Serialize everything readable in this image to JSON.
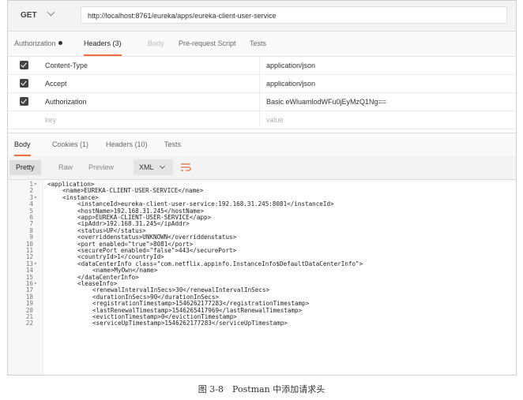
{
  "request": {
    "method": "GET",
    "url": "http://localhost:8761/eureka/apps/eureka-client-user-service"
  },
  "request_tabs": [
    "Authorization",
    "Headers (3)",
    "Body",
    "Pre-request Script",
    "Tests"
  ],
  "headers": {
    "rows": [
      {
        "key": "Content-Type",
        "value": "application/json"
      },
      {
        "key": "Accept",
        "value": "application/json"
      },
      {
        "key": "Authorization",
        "value": "Basic eWluamlodWFu0jEyMzQ1Ng=="
      }
    ],
    "key_placeholder": "key",
    "value_placeholder": "value"
  },
  "response_tabs": [
    "Body",
    "Cookies (1)",
    "Headers (10)",
    "Tests"
  ],
  "viewer": {
    "modes": [
      "Pretty",
      "Raw",
      "Preview"
    ],
    "format": "XML"
  },
  "code_lines": [
    {
      "n": "1",
      "fold": "▾",
      "indent": 0,
      "text": "<application>"
    },
    {
      "n": "2",
      "fold": "",
      "indent": 1,
      "text": "<name>EUREKA-CLIENT-USER-SERVICE</name>"
    },
    {
      "n": "3",
      "fold": "▾",
      "indent": 1,
      "text": "<instance>"
    },
    {
      "n": "4",
      "fold": "",
      "indent": 2,
      "text": "<instanceId>eureka-client-user-service:192.168.31.245:8081</instanceId>"
    },
    {
      "n": "5",
      "fold": "",
      "indent": 2,
      "text": "<hostName>192.168.31.245</hostName>"
    },
    {
      "n": "6",
      "fold": "",
      "indent": 2,
      "text": "<app>EUREKA-CLIENT-USER-SERVICE</app>"
    },
    {
      "n": "7",
      "fold": "",
      "indent": 2,
      "text": "<ipAddr>192.168.31.245</ipAddr>"
    },
    {
      "n": "8",
      "fold": "",
      "indent": 2,
      "text": "<status>UP</status>"
    },
    {
      "n": "9",
      "fold": "",
      "indent": 2,
      "text": "<overriddenstatus>UNKNOWN</overriddenstatus>"
    },
    {
      "n": "10",
      "fold": "",
      "indent": 2,
      "text": "<port enabled=\"true\">8081</port>"
    },
    {
      "n": "11",
      "fold": "",
      "indent": 2,
      "text": "<securePort enabled=\"false\">443</securePort>"
    },
    {
      "n": "12",
      "fold": "",
      "indent": 2,
      "text": "<countryId>1</countryId>"
    },
    {
      "n": "13",
      "fold": "▾",
      "indent": 2,
      "text": "<dataCenterInfo class=\"com.netflix.appinfo.InstanceInfo$DefaultDataCenterInfo\">"
    },
    {
      "n": "14",
      "fold": "",
      "indent": 3,
      "text": "<name>MyOwn</name>"
    },
    {
      "n": "15",
      "fold": "",
      "indent": 2,
      "text": "</dataCenterInfo>"
    },
    {
      "n": "16",
      "fold": "▾",
      "indent": 2,
      "text": "<leaseInfo>"
    },
    {
      "n": "17",
      "fold": "",
      "indent": 3,
      "text": "<renewalIntervalInSecs>30</renewalIntervalInSecs>"
    },
    {
      "n": "18",
      "fold": "",
      "indent": 3,
      "text": "<durationInSecs>90</durationInSecs>"
    },
    {
      "n": "19",
      "fold": "",
      "indent": 3,
      "text": "<registrationTimestamp>1546262177283</registrationTimestamp>"
    },
    {
      "n": "20",
      "fold": "",
      "indent": 3,
      "text": "<lastRenewalTimestamp>1546265417969</lastRenewalTimestamp>"
    },
    {
      "n": "21",
      "fold": "",
      "indent": 3,
      "text": "<evictionTimestamp>0</evictionTimestamp>"
    },
    {
      "n": "22",
      "fold": "",
      "indent": 3,
      "text": "<serviceUpTimestamp>1546262177283</serviceUpTimestamp>"
    }
  ],
  "caption": "图 3-8　Postman 中添加请求头"
}
